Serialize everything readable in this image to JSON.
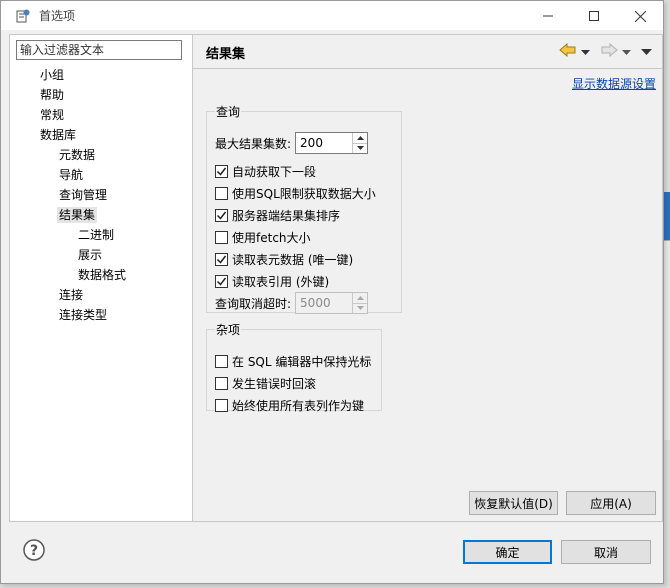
{
  "window": {
    "title": "首选项"
  },
  "filter": {
    "placeholder": "输入过滤器文本"
  },
  "tree": [
    {
      "label": "小组",
      "level": 0
    },
    {
      "label": "帮助",
      "level": 0
    },
    {
      "label": "常规",
      "level": 0
    },
    {
      "label": "数据库",
      "level": 0
    },
    {
      "label": "元数据",
      "level": 1
    },
    {
      "label": "导航",
      "level": 1
    },
    {
      "label": "查询管理",
      "level": 1
    },
    {
      "label": "结果集",
      "level": 1,
      "selected": true
    },
    {
      "label": "二进制",
      "level": 2
    },
    {
      "label": "展示",
      "level": 2
    },
    {
      "label": "数据格式",
      "level": 2
    },
    {
      "label": "连接",
      "level": 1
    },
    {
      "label": "连接类型",
      "level": 1
    }
  ],
  "page": {
    "title": "结果集",
    "datasource_link": "显示数据源设置"
  },
  "query_group": {
    "legend": "查询",
    "max_results_label": "最大结果集数:",
    "max_results_value": "200",
    "options": [
      {
        "label": "自动获取下一段",
        "checked": true
      },
      {
        "label": "使用SQL限制获取数据大小",
        "checked": false
      },
      {
        "label": "服务器端结果集排序",
        "checked": true
      },
      {
        "label": "使用fetch大小",
        "checked": false
      },
      {
        "label": "读取表元数据 (唯一键)",
        "checked": true
      },
      {
        "label": "读取表引用 (外键)",
        "checked": true
      }
    ],
    "timeout_label": "查询取消超时:",
    "timeout_value": "5000"
  },
  "misc_group": {
    "legend": "杂项",
    "options": [
      {
        "label": "在 SQL 编辑器中保持光标",
        "checked": false
      },
      {
        "label": "发生错误时回滚",
        "checked": false
      },
      {
        "label": "始终使用所有表列作为键",
        "checked": false
      }
    ]
  },
  "buttons": {
    "restore": "恢复默认值(D)",
    "apply": "应用(A)",
    "ok": "确定",
    "cancel": "取消"
  },
  "colors": {
    "link": "#0645ad",
    "default_button_border": "#0078d7"
  }
}
